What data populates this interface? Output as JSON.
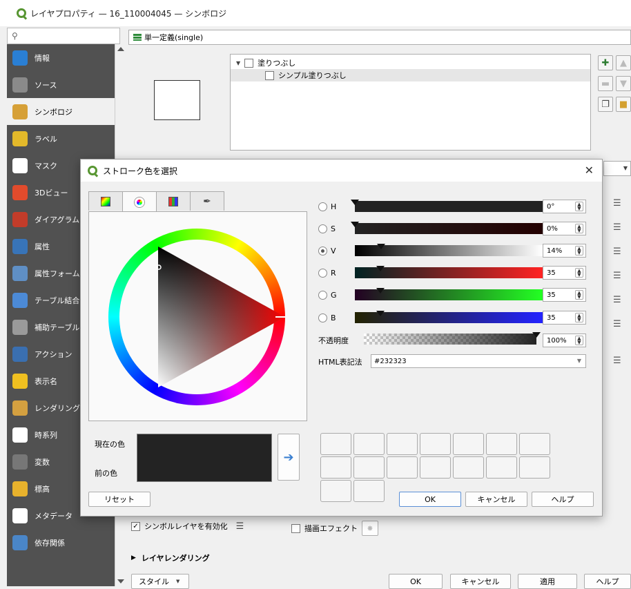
{
  "window_title": "レイヤプロパティ — 16_110004045 — シンボロジ",
  "search": {
    "placeholder": ""
  },
  "sidebar": {
    "items": [
      {
        "label": "情報",
        "icon": "info-icon",
        "color": "#2a7fd4"
      },
      {
        "label": "ソース",
        "icon": "wrench-icon",
        "color": "#8a8a8a"
      },
      {
        "label": "シンボロジ",
        "icon": "paintbrush-icon",
        "color": "#d6a037"
      },
      {
        "label": "ラベル",
        "icon": "abc-label-icon",
        "color": "#e3b92a"
      },
      {
        "label": "マスク",
        "icon": "abc-mask-icon",
        "color": "#ffffff"
      },
      {
        "label": "3Dビュー",
        "icon": "cube-icon",
        "color": "#e14b2c"
      },
      {
        "label": "ダイアグラム",
        "icon": "diagram-icon",
        "color": "#c23c2a"
      },
      {
        "label": "属性",
        "icon": "table-icon",
        "color": "#3874b8"
      },
      {
        "label": "属性フォーム",
        "icon": "form-icon",
        "color": "#5f8fc5"
      },
      {
        "label": "テーブル結合",
        "icon": "join-icon",
        "color": "#4c8ad6"
      },
      {
        "label": "補助テーブル",
        "icon": "database-icon",
        "color": "#9a9a9a"
      },
      {
        "label": "アクション",
        "icon": "gear-icon",
        "color": "#3a6fb0"
      },
      {
        "label": "表示名",
        "icon": "speech-bubble-icon",
        "color": "#f0c020"
      },
      {
        "label": "レンダリング",
        "icon": "brush-icon",
        "color": "#d4a040"
      },
      {
        "label": "時系列",
        "icon": "clock-icon",
        "color": "#ffffff"
      },
      {
        "label": "変数",
        "icon": "epsilon-icon",
        "color": "#777777"
      },
      {
        "label": "標高",
        "icon": "elevation-icon",
        "color": "#e8b22c"
      },
      {
        "label": "メタデータ",
        "icon": "metadata-icon",
        "color": "#ffffff"
      },
      {
        "label": "依存関係",
        "icon": "dependency-icon",
        "color": "#4a86c8"
      }
    ],
    "active_index": 2
  },
  "renderer": {
    "label": "単一定義(single)"
  },
  "tree": {
    "root": "塗りつぶし",
    "child": "シンプル塗りつぶし"
  },
  "dialog": {
    "title": "ストローク色を選択",
    "tabs": [
      "gradient-square-icon",
      "color-wheel-icon",
      "palette-grid-icon",
      "eyedropper-icon"
    ],
    "active_tab": 1,
    "channels": [
      {
        "name": "H",
        "value": "0°",
        "level": 0.0,
        "selected": false
      },
      {
        "name": "S",
        "value": "0%",
        "level": 0.0,
        "selected": false
      },
      {
        "name": "V",
        "value": "14%",
        "level": 0.14,
        "selected": true
      },
      {
        "name": "R",
        "value": "35",
        "level": 0.137,
        "selected": false
      },
      {
        "name": "G",
        "value": "35",
        "level": 0.137,
        "selected": false
      },
      {
        "name": "B",
        "value": "35",
        "level": 0.137,
        "selected": false
      }
    ],
    "opacity_label": "不透明度",
    "opacity_value": "100%",
    "opacity_level": 1.0,
    "html_label": "HTML表記法",
    "html_value": "#232323",
    "current_color_label": "現在の色",
    "previous_color_label": "前の色",
    "color": "#232323",
    "reset_label": "リセット",
    "ok_label": "OK",
    "cancel_label": "キャンセル",
    "help_label": "ヘルプ"
  },
  "bottom": {
    "enable_layer_label": "シンボルレイヤを有効化",
    "effect_label": "描画エフェクト",
    "layer_rendering_label": "レイヤレンダリング",
    "style_label": "スタイル",
    "ok_label": "OK",
    "cancel_label": "キャンセル",
    "apply_label": "適用",
    "help_label": "ヘルプ"
  }
}
